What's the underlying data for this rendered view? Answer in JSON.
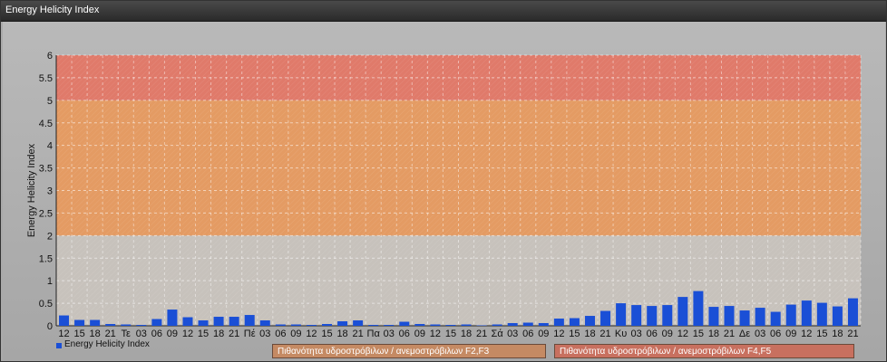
{
  "window": {
    "title": "Energy Helicity Index"
  },
  "colors": {
    "bar": "#1a4fd6",
    "band_low": "#c7c2bc",
    "band_mid": "#e49b63",
    "band_high": "#e07a6a",
    "band_label_mid": "#c58a63",
    "band_label_high": "#c8705f"
  },
  "chart_data": {
    "type": "bar",
    "title": "",
    "ylabel": "Energy Helicity Index",
    "xlabel": "",
    "ylim": [
      0,
      6
    ],
    "yticks": [
      "0",
      "0.5",
      "1",
      "1.5",
      "2",
      "2.5",
      "3",
      "3.5",
      "4",
      "4.5",
      "5",
      "5.5",
      "6"
    ],
    "grid": true,
    "legend_position": "bottom-left",
    "categories": [
      "12",
      "15",
      "18",
      "21",
      "Τε",
      "03",
      "06",
      "09",
      "12",
      "15",
      "18",
      "21",
      "Πέ",
      "03",
      "06",
      "09",
      "12",
      "15",
      "18",
      "21",
      "Πα",
      "03",
      "06",
      "09",
      "12",
      "15",
      "18",
      "21",
      "Σά",
      "03",
      "06",
      "09",
      "12",
      "15",
      "18",
      "21",
      "Κυ",
      "03",
      "06",
      "09",
      "12",
      "15",
      "18",
      "21",
      "Δε",
      "03",
      "06",
      "09",
      "12",
      "15",
      "18",
      "21"
    ],
    "series": [
      {
        "name": "Energy Helicity Index",
        "values": [
          0.23,
          0.13,
          0.13,
          0.04,
          0.03,
          0.02,
          0.15,
          0.36,
          0.19,
          0.12,
          0.2,
          0.2,
          0.24,
          0.12,
          0.03,
          0.03,
          0.02,
          0.04,
          0.1,
          0.12,
          0.02,
          0.02,
          0.09,
          0.04,
          0.03,
          0.02,
          0.03,
          0.01,
          0.03,
          0.06,
          0.07,
          0.06,
          0.16,
          0.17,
          0.22,
          0.33,
          0.5,
          0.46,
          0.44,
          0.46,
          0.64,
          0.77,
          0.42,
          0.44,
          0.34,
          0.4,
          0.31,
          0.47,
          0.56,
          0.51,
          0.43,
          0.61
        ]
      }
    ],
    "bands": [
      {
        "from": 2,
        "to": 5,
        "label": "Πιθανότητα υδροστρόβιλων / ανεμοστρόβιλων F2,F3"
      },
      {
        "from": 5,
        "to": 6,
        "label": "Πιθανότητα υδροστρόβιλων / ανεμοστρόβιλων F4,F5"
      }
    ]
  },
  "legend": {
    "series_label": "Energy Helicity Index",
    "band_mid_label": "Πιθανότητα υδροστρόβιλων / ανεμοστρόβιλων F2,F3",
    "band_high_label": "Πιθανότητα υδροστρόβιλων / ανεμοστρόβιλων F4,F5"
  }
}
